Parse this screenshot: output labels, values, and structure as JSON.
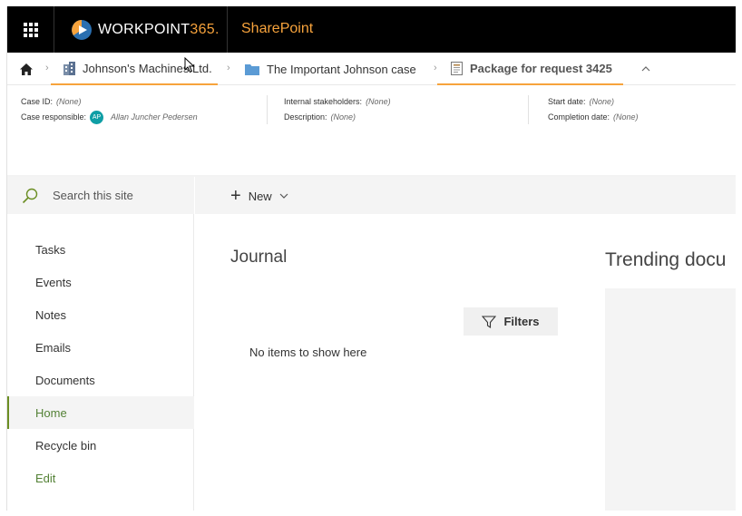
{
  "topbar": {
    "brand_main": "WORKPOINT",
    "brand_accent": "365.",
    "site_title": "SharePoint"
  },
  "breadcrumb": {
    "items": [
      {
        "label": "Johnson's Machines Ltd.",
        "icon": "building-icon"
      },
      {
        "label": "The Important Johnson case",
        "icon": "folder-icon"
      },
      {
        "label": "Package for request 3425",
        "icon": "package-icon"
      }
    ]
  },
  "meta": {
    "case_id_label": "Case ID:",
    "case_id_value": "(None)",
    "case_responsible_label": "Case responsible:",
    "case_responsible_initials": "AP",
    "case_responsible_value": "Allan Juncher Pedersen",
    "internal_stakeholders_label": "Internal stakeholders:",
    "internal_stakeholders_value": "(None)",
    "description_label": "Description:",
    "description_value": "(None)",
    "start_date_label": "Start date:",
    "start_date_value": "(None)",
    "completion_date_label": "Completion date:",
    "completion_date_value": "(None)"
  },
  "search": {
    "placeholder": "Search this site"
  },
  "nav": {
    "items": [
      "Tasks",
      "Events",
      "Notes",
      "Emails",
      "Documents",
      "Home",
      "Recycle bin"
    ],
    "active": "Home",
    "edit_label": "Edit"
  },
  "command_bar": {
    "new_label": "New"
  },
  "journal": {
    "title": "Journal",
    "filters_label": "Filters",
    "empty_text": "No items to show here"
  },
  "trending": {
    "title": "Trending docu"
  },
  "colors": {
    "accent": "#f7a33c",
    "link_green": "#538135",
    "topbar": "#000000"
  }
}
